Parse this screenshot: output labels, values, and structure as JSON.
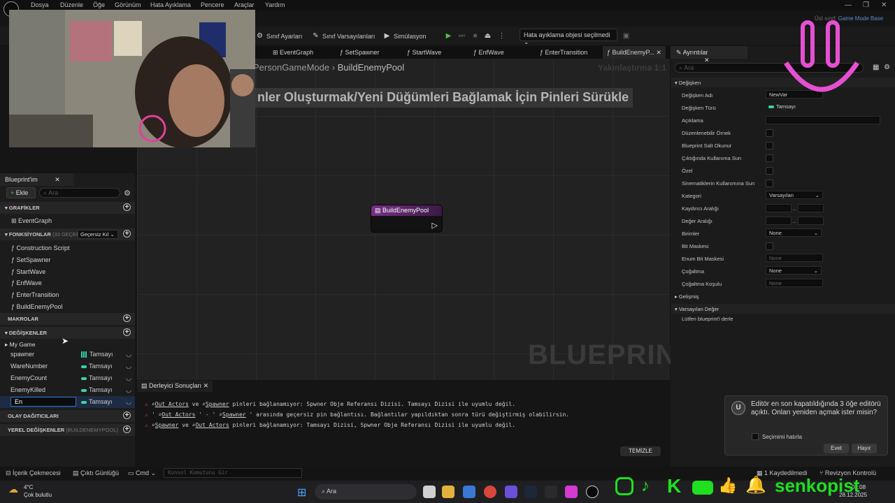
{
  "menu": [
    "Dosya",
    "Düzenle",
    "Öğe",
    "Görünüm",
    "Hata Ayıklama",
    "Pencere",
    "Araçlar",
    "Yardım"
  ],
  "parent_class": {
    "label": "Üst sınıf:",
    "value": "Game Mode Base"
  },
  "toolbar": {
    "class_settings": "Sınıf Ayarları",
    "class_defaults": "Sınıf Varsayılanları",
    "simulation": "Simülasyon",
    "debug_object": "Hata ayıklama objesi seçilmedi"
  },
  "tabs": [
    "EventGraph",
    "SetSpawner",
    "StartWave",
    "EnfWave",
    "EnterTransition",
    "BuildEnemyP..."
  ],
  "graph": {
    "breadcrumb_root": "PersonGameMode",
    "breadcrumb_sep": "›",
    "breadcrumb_current": "BuildEnemyPool",
    "zoom": "Yakınlaştırma 1:1",
    "hint": "nler Oluşturmak/Yeni Düğümleri Bağlamak İçin Pinleri Sürükle",
    "watermark": "BLUEPRINT",
    "node_title": "BuildEnemyPool"
  },
  "mybp": {
    "tab": "Blueprint'im",
    "add": "Ekle",
    "search_placeholder": "Ara",
    "graphs_header": "GRAFİKLER",
    "graphs": [
      "EventGraph"
    ],
    "functions_header": "FONKSİYONLAR",
    "functions_count": "(33 GEÇERSİ",
    "override": "Geçersiz Kıl",
    "functions": [
      "Construction Script",
      "SetSpawner",
      "StartWave",
      "EnfWave",
      "EnterTransition",
      "BuildEnemyPool"
    ],
    "macros_header": "MAKROLAR",
    "variables_header": "DEĞİŞKENLER",
    "category": "My Game",
    "variables": [
      {
        "name": "spawner",
        "type": "Tamsayı"
      },
      {
        "name": "WareNumber",
        "type": "Tamsayı"
      },
      {
        "name": "EnemyCount",
        "type": "Tamsayı"
      },
      {
        "name": "EnemyKilled",
        "type": "Tamsayı"
      },
      {
        "name": "En",
        "type": "Tamsayı"
      }
    ],
    "dispatchers_header": "OLAY DAĞITICILARI",
    "locals_header": "YEREL DEĞİŞKENLER",
    "locals_sub": "(BUILDENEMYPOOL)"
  },
  "compiler": {
    "tab": "Derleyici Sonuçları",
    "line1": {
      "a": "Out Actors",
      "m1": " ve ",
      "b": "Spawner",
      "m2": " pinleri bağlanamıyor: Spwner Obje Referansı Dizisi. Tamsayı Dizisi ile uyumlu değil."
    },
    "line2": {
      "p": "' ",
      "a": "Out Actors",
      "m1": " ' - ' ",
      "b": "Spawner",
      "m2": " ' arasında geçersiz pin bağlantısı. Bağlantılar yapıldıktan sonra türü değiştirmiş olabilirsin."
    },
    "line3": {
      "a": "Spawner",
      "m1": " ve ",
      "b": "Out Actors",
      "m2": " pinleri bağlanamıyor: Tamsayı Dizisi, Spwner Obje Referansı Dizisi ile uyumlu değil."
    },
    "clear": "TEMİZLE"
  },
  "details": {
    "tab": "Ayrıntılar",
    "search_placeholder": "Ara",
    "section_variable": "Değişken",
    "var_name_label": "Değişken Adı",
    "var_name": "NewVar",
    "var_type_label": "Değişken Türü",
    "var_type": "Tamsayı",
    "description": "Açıklama",
    "editable": "Düzenlenebilir Örnek",
    "readonly": "Blueprint Salt Okunur",
    "expose_spawn": "Çıktığında Kullanıma Sun",
    "private": "Özel",
    "expose_cine": "Sinematiklerin Kullanımına Sun",
    "category_label": "Kategori",
    "category_value": "Varsayılan",
    "slider_range": "Kaydırıcı Aralığı",
    "value_range": "Değer Aralığı",
    "range_sep": "..",
    "units": "Birimler",
    "units_value": "None",
    "bitmask": "Bit Maskesi",
    "enum_bitmask": "Enum Bit Maskesi",
    "enum_value": "None",
    "replication": "Çoğaltma",
    "replication_value": "None",
    "rep_condition": "Çoğaltma Koşulu",
    "rep_condition_value": "None",
    "advanced": "Gelişmiş",
    "default_section": "Varsayılan Değer",
    "compile_msg": "Lütfen blueprint'i derle"
  },
  "notification": {
    "text": "Editör en son kapatıldığında 3 öğe editörü açıktı. Onları yeniden açmak ister misin?",
    "remember": "Seçimimi hatırla",
    "yes": "Evet",
    "no": "Hayır"
  },
  "status": {
    "content_drawer": "İçerik Çekmecesi",
    "output_log": "Çıktı Günlüğü",
    "cmd": "Cmd",
    "console_placeholder": "Konsol Komutunu Gir",
    "saved": "1 Kaydedilmedi",
    "revision": "Revizyon Kontrolü"
  },
  "taskbar": {
    "temp": "4°C",
    "weather": "Çok bulutlu",
    "search": "Ara",
    "time": "01:08",
    "date": "28.12.2025"
  },
  "overlay": {
    "brand": "senkopist"
  },
  "colors": {
    "accent": "#4fc346",
    "node": "#7a2f8a",
    "smile": "#e64fd2",
    "brand": "#1ee01e",
    "error": "#d04040"
  }
}
